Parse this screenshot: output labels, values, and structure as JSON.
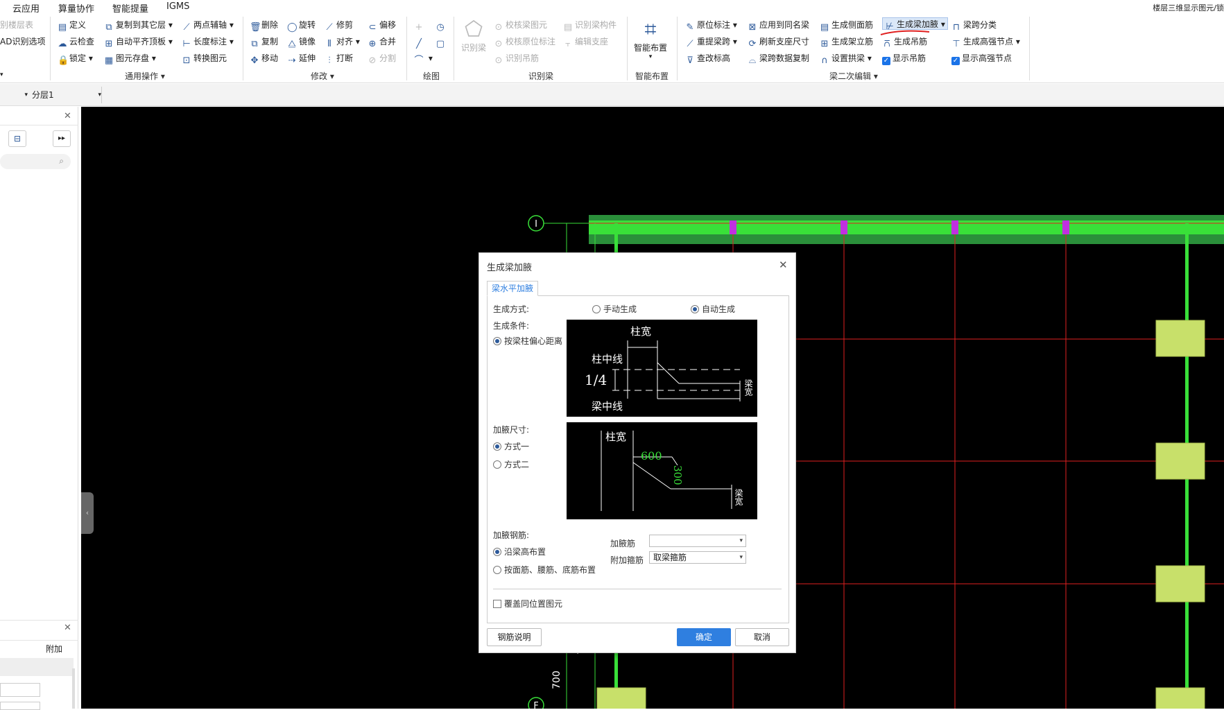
{
  "menu": [
    "云应用",
    "算量协作",
    "智能提量",
    "IGMS"
  ],
  "title_right": "楼层三维显示图元/锁",
  "ribbon": {
    "left_items": [
      "别楼层表",
      "AD识别选项"
    ],
    "general_ops": {
      "items": [
        "定义",
        "云检查",
        "锁定",
        "复制到其它层",
        "自动平齐顶板",
        "图元存盘",
        "两点辅轴",
        "长度标注",
        "转换图元"
      ],
      "group": "通用操作"
    },
    "modify": {
      "items": [
        "删除",
        "复制",
        "移动",
        "旋转",
        "镜像",
        "延伸",
        "修剪",
        "对齐",
        "打断",
        "偏移",
        "合并",
        "分割"
      ],
      "group": "修改"
    },
    "draw": {
      "group": "绘图"
    },
    "identify": {
      "big": "识别梁",
      "items": [
        "校核梁图元",
        "校核原位标注",
        "识别吊筋",
        "识别梁构件",
        "编辑支座"
      ],
      "group": "识别梁"
    },
    "smart": {
      "big": "智能布置",
      "group": "智能布置"
    },
    "beam_edit": {
      "items": [
        "原位标注",
        "重提梁跨",
        "查改标高",
        "应用到同名梁",
        "刷新支座尺寸",
        "梁跨数据复制",
        "生成侧面筋",
        "生成架立筋",
        "设置拱梁",
        "生成梁加腋",
        "生成吊筋",
        "显示吊筋",
        "梁跨分类",
        "生成高强节点",
        "显示高强节点"
      ],
      "group": "梁二次编辑"
    }
  },
  "toolbar2": {
    "layer": "分层1"
  },
  "left_panel": {
    "col_label": "附加"
  },
  "canvas": {
    "axis_i": "I",
    "axis_f": "F",
    "dim_700": "700",
    "dim_7": "7"
  },
  "dialog": {
    "title": "生成梁加腋",
    "tab": "梁水平加腋",
    "gen_mode_label": "生成方式:",
    "manual": "手动生成",
    "auto": "自动生成",
    "gen_cond_label": "生成条件:",
    "cond_option": "按梁柱偏心距离",
    "diag1": {
      "col_width": "柱宽",
      "col_center": "柱中线",
      "quarter": "1/4",
      "beam_center": "梁中线",
      "beam_width": "梁宽"
    },
    "size_label": "加腋尺寸:",
    "mode1": "方式一",
    "mode2": "方式二",
    "diag2": {
      "col_width": "柱宽",
      "v600": "600",
      "v300": "300",
      "beam_width": "梁宽"
    },
    "rebar_label": "加腋钢筋:",
    "rebar_opt1": "沿梁高布置",
    "rebar_opt2": "按面筋、腰筋、底筋布置",
    "haunch_bar_label": "加腋筋",
    "haunch_bar_value": "",
    "stirrup_label": "附加箍筋",
    "stirrup_value": "取梁箍筋",
    "overwrite": "覆盖同位置图元",
    "btn_rebar_doc": "钢筋说明",
    "btn_ok": "确定",
    "btn_cancel": "取消"
  }
}
